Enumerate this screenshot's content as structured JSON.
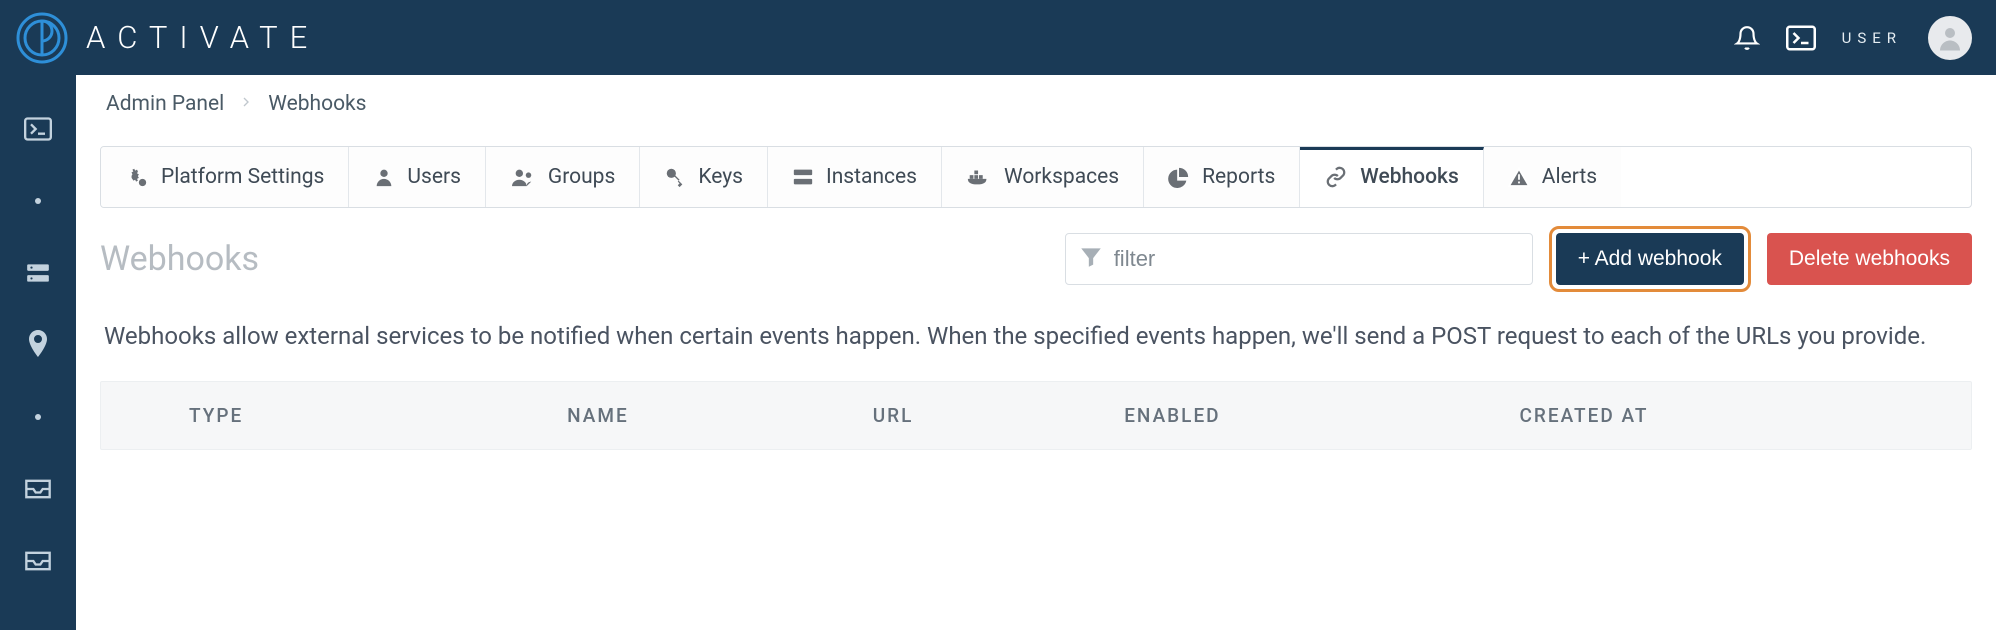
{
  "brand": {
    "name": "ACTIVATE"
  },
  "topbar": {
    "user_label": "USER"
  },
  "breadcrumbs": [
    {
      "label": "Admin Panel"
    },
    {
      "label": "Webhooks"
    }
  ],
  "tabs": [
    {
      "label": "Platform Settings"
    },
    {
      "label": "Users"
    },
    {
      "label": "Groups"
    },
    {
      "label": "Keys"
    },
    {
      "label": "Instances"
    },
    {
      "label": "Workspaces"
    },
    {
      "label": "Reports"
    },
    {
      "label": "Webhooks"
    },
    {
      "label": "Alerts"
    }
  ],
  "page": {
    "title": "Webhooks",
    "filter_placeholder": "filter",
    "add_button": "+ Add webhook",
    "delete_button": "Delete webhooks",
    "description": "Webhooks allow external services to be notified when certain events happen. When the specified events happen, we'll send a POST request to each of the URLs you provide."
  },
  "table": {
    "columns": [
      "TYPE",
      "NAME",
      "URL",
      "ENABLED",
      "CREATED AT"
    ],
    "rows": []
  }
}
